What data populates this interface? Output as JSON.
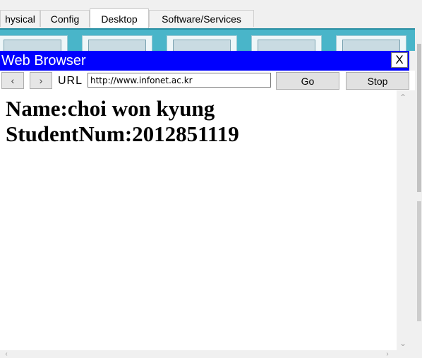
{
  "tabs": [
    {
      "label": "hysical",
      "active": false
    },
    {
      "label": "Config",
      "active": false
    },
    {
      "label": "Desktop",
      "active": true
    },
    {
      "label": "Software/Services",
      "active": false
    }
  ],
  "browser": {
    "title": "Web Browser",
    "close_label": "X",
    "back_icon": "‹",
    "forward_icon": "›",
    "url_label": "URL",
    "url_value": "http://www.infonet.ac.kr",
    "go_label": "Go",
    "stop_label": "Stop"
  },
  "page": {
    "line1": "Name:choi won kyung",
    "line2": "StudentNum:2012851119"
  },
  "colors": {
    "title_bar": "#0000ff",
    "desktop_strip": "#49b5c9"
  }
}
